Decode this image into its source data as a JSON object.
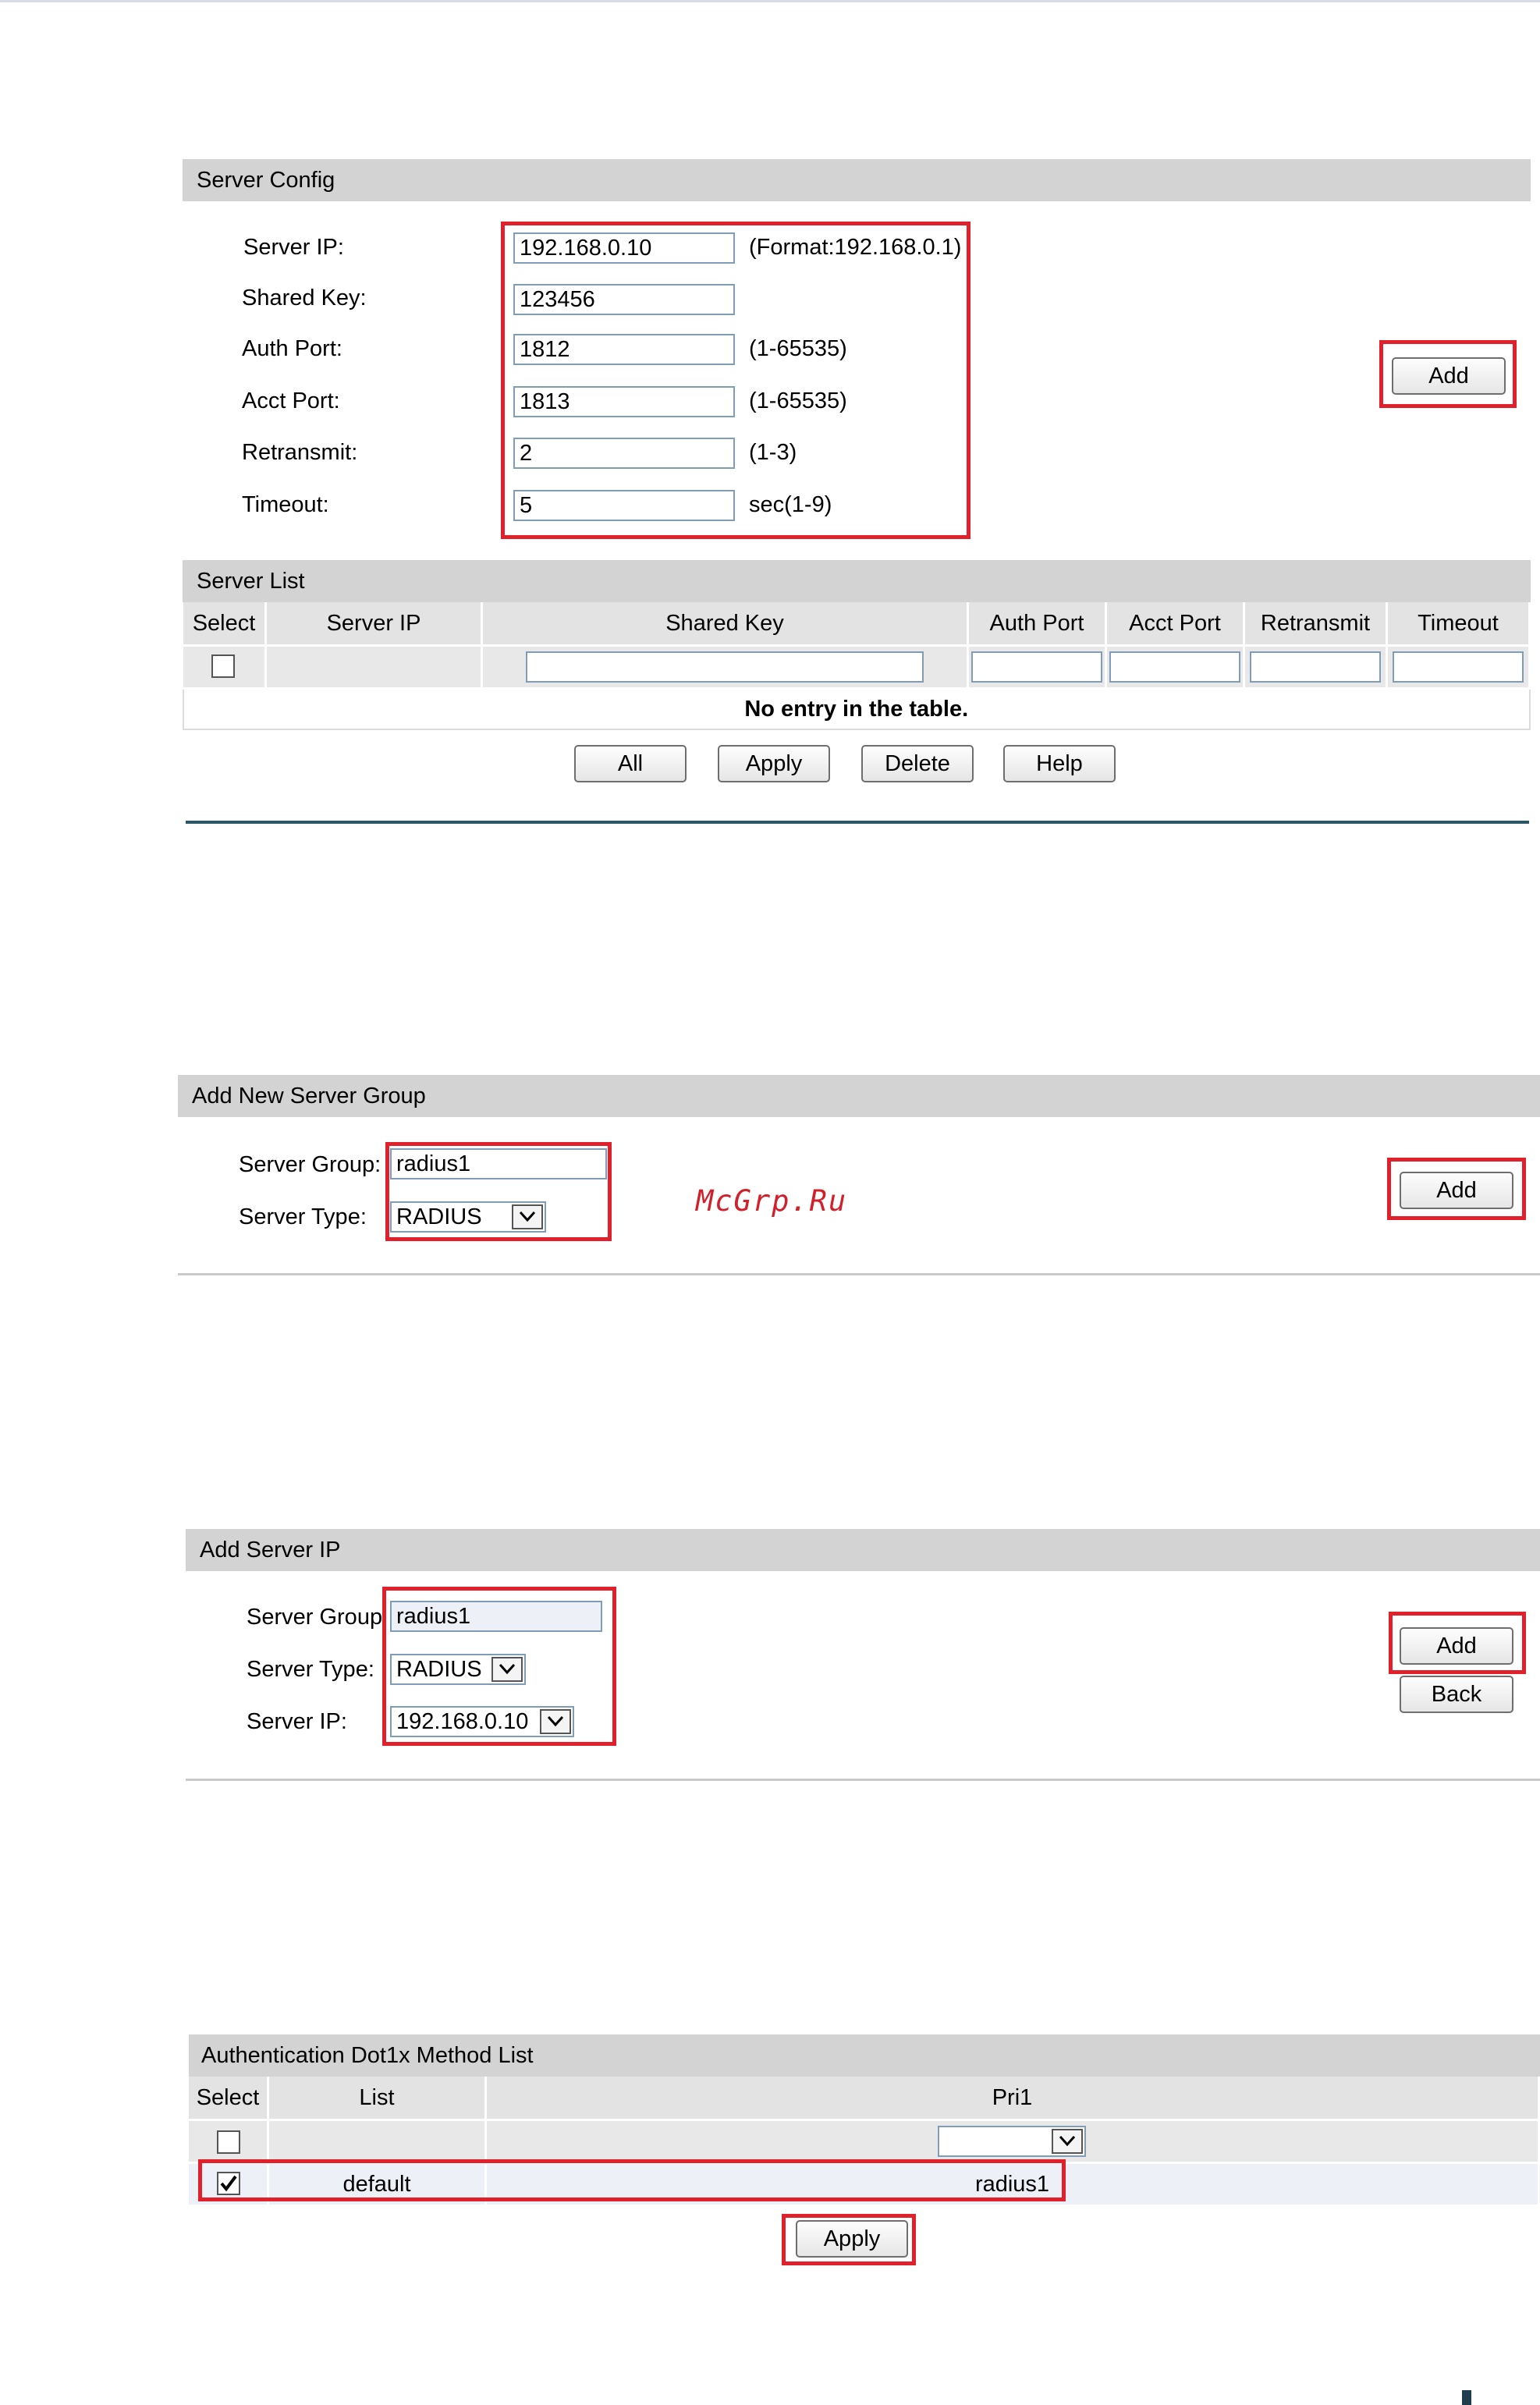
{
  "server_config": {
    "title": "Server Config",
    "rows": [
      {
        "label": "Server IP:",
        "value": "192.168.0.10",
        "hint": "(Format:192.168.0.1)"
      },
      {
        "label": "Shared Key:",
        "value": "123456",
        "hint": ""
      },
      {
        "label": "Auth Port:",
        "value": "1812",
        "hint": "(1-65535)"
      },
      {
        "label": "Acct Port:",
        "value": "1813",
        "hint": "(1-65535)"
      },
      {
        "label": "Retransmit:",
        "value": "2",
        "hint": "(1-3)"
      },
      {
        "label": "Timeout:",
        "value": "5",
        "hint": "sec(1-9)"
      }
    ],
    "add_label": "Add"
  },
  "server_list": {
    "title": "Server List",
    "columns": [
      "Select",
      "Server IP",
      "Shared Key",
      "Auth Port",
      "Acct Port",
      "Retransmit",
      "Timeout"
    ],
    "empty_message": "No entry in the table.",
    "buttons": {
      "all": "All",
      "apply": "Apply",
      "delete": "Delete",
      "help": "Help"
    }
  },
  "add_new_server_group": {
    "title": "Add New Server Group",
    "group_label": "Server Group:",
    "group_value": "radius1",
    "type_label": "Server Type:",
    "type_value": "RADIUS",
    "add_label": "Add"
  },
  "watermark": "McGrp.Ru",
  "add_server_ip": {
    "title": "Add Server IP",
    "group_label": "Server Group",
    "group_value": "radius1",
    "type_label": "Server Type:",
    "type_value": "RADIUS",
    "ip_label": "Server IP:",
    "ip_value": "192.168.0.10",
    "add_label": "Add",
    "back_label": "Back"
  },
  "method_list": {
    "title": "Authentication Dot1x Method List",
    "columns": [
      "Select",
      "List",
      "Pri1"
    ],
    "rows": [
      {
        "list": "default",
        "pri1": "radius1",
        "checked": true
      }
    ],
    "apply_label": "Apply"
  }
}
